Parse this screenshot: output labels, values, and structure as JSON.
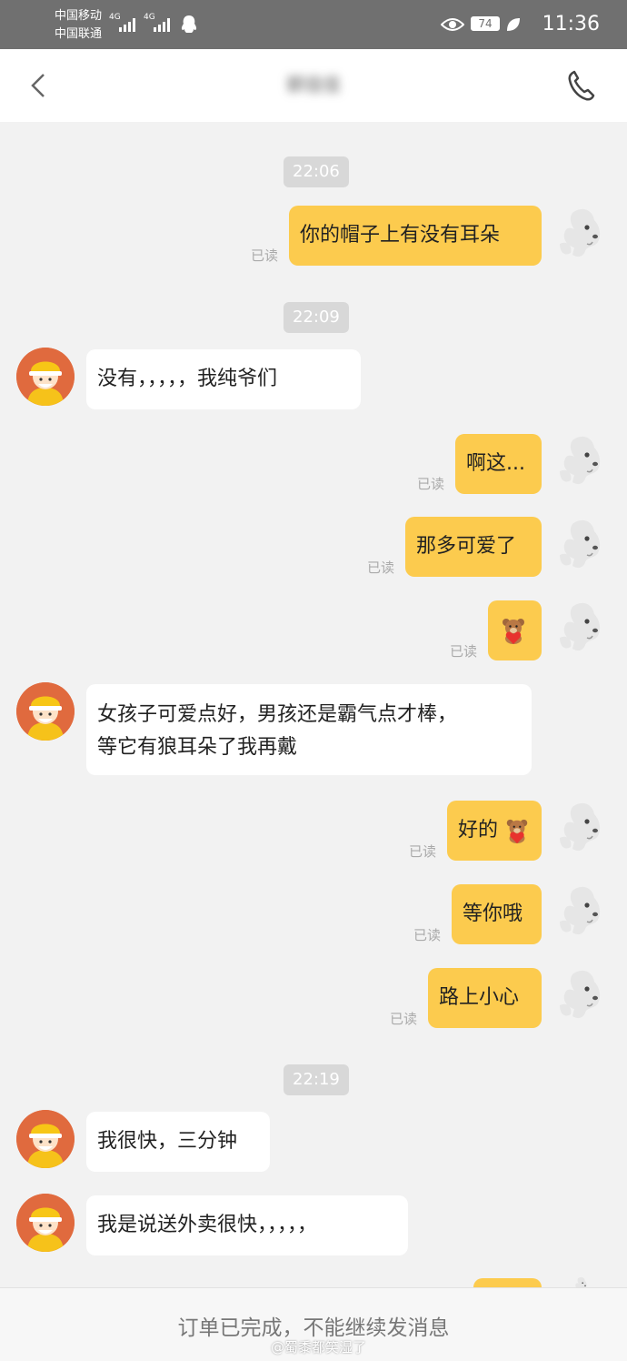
{
  "status_bar": {
    "carrier_1": "中国移动",
    "carrier_2": "中国联通",
    "signal_1": "4G",
    "signal_2": "4G",
    "battery": "74",
    "time": "11:36"
  },
  "header": {
    "title": "郭佳佳"
  },
  "messages": [
    {
      "kind": "timestamp",
      "text": "22:06"
    },
    {
      "kind": "out",
      "text": "你的帽子上有没有耳朵",
      "read": "已读"
    },
    {
      "kind": "timestamp",
      "text": "22:09"
    },
    {
      "kind": "in",
      "text": "没有，，，，，我纯爷们"
    },
    {
      "kind": "out",
      "text": "啊这...",
      "read": "已读"
    },
    {
      "kind": "out",
      "text": "那多可爱了",
      "read": "已读"
    },
    {
      "kind": "out",
      "sticker": "bear-heart",
      "read": "已读"
    },
    {
      "kind": "in",
      "lines": [
        "女孩子可爱点好，男孩还是霸气点才棒，",
        "等它有狼耳朵了我再戴"
      ]
    },
    {
      "kind": "out",
      "text": "好的",
      "sticker": "bear-heart",
      "read": "已读"
    },
    {
      "kind": "out",
      "text": "等你哦",
      "read": "已读"
    },
    {
      "kind": "out",
      "text": "路上小心",
      "read": "已读"
    },
    {
      "kind": "timestamp",
      "text": "22:19"
    },
    {
      "kind": "in",
      "text": "我很快，三分钟"
    },
    {
      "kind": "in",
      "text": "我是说送外卖很快，，，，，"
    }
  ],
  "footer": {
    "notice": "订单已完成，不能继续发消息"
  },
  "watermark": "@蜀黍都笑湿了",
  "colors": {
    "outgoing_bubble": "#fccb4e",
    "incoming_bubble": "#ffffff",
    "background": "#f2f2f2"
  },
  "icons": [
    "back-chevron-icon",
    "phone-icon",
    "eye-icon",
    "battery-icon",
    "leaf-icon",
    "qq-icon",
    "dog-avatar",
    "courier-avatar",
    "bear-heart-sticker"
  ]
}
